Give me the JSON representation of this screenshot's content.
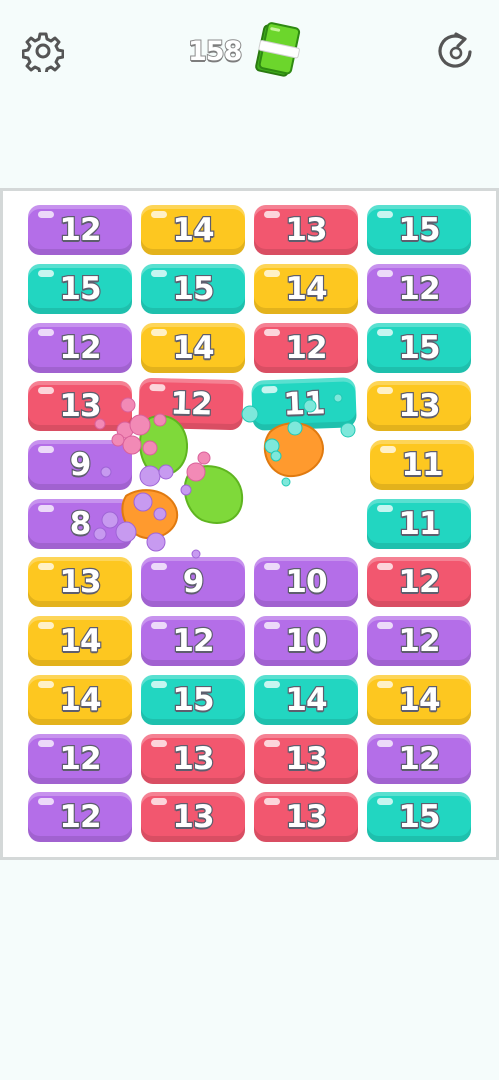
{
  "header": {
    "settings_icon": "gear-icon",
    "restart_icon": "restart-arrow-icon",
    "cash_icon": "cash-stack-icon",
    "score": "158"
  },
  "colors": {
    "purple": "#b46ee8",
    "yellow": "#fdc720",
    "pink": "#f2576f",
    "teal": "#22d6c1"
  },
  "board": {
    "tiles": [
      {
        "value": "12",
        "color": "purple"
      },
      {
        "value": "14",
        "color": "yellow"
      },
      {
        "value": "13",
        "color": "pink"
      },
      {
        "value": "15",
        "color": "teal"
      },
      {
        "value": "15",
        "color": "teal"
      },
      {
        "value": "15",
        "color": "teal"
      },
      {
        "value": "14",
        "color": "yellow"
      },
      {
        "value": "12",
        "color": "purple"
      },
      {
        "value": "12",
        "color": "purple"
      },
      {
        "value": "14",
        "color": "yellow"
      },
      {
        "value": "12",
        "color": "pink"
      },
      {
        "value": "15",
        "color": "teal"
      },
      {
        "value": "13",
        "color": "pink"
      },
      {
        "value": "12",
        "color": "pink"
      },
      {
        "value": "11",
        "color": "teal"
      },
      {
        "value": "13",
        "color": "yellow"
      },
      {
        "value": "9",
        "color": "purple"
      },
      {
        "value": "11",
        "color": "yellow"
      },
      {
        "value": "8",
        "color": "purple"
      },
      {
        "value": "11",
        "color": "teal"
      },
      {
        "value": "13",
        "color": "yellow"
      },
      {
        "value": "9",
        "color": "purple"
      },
      {
        "value": "10",
        "color": "purple"
      },
      {
        "value": "12",
        "color": "pink"
      },
      {
        "value": "14",
        "color": "yellow"
      },
      {
        "value": "12",
        "color": "purple"
      },
      {
        "value": "10",
        "color": "purple"
      },
      {
        "value": "12",
        "color": "purple"
      },
      {
        "value": "14",
        "color": "yellow"
      },
      {
        "value": "15",
        "color": "teal"
      },
      {
        "value": "14",
        "color": "teal"
      },
      {
        "value": "14",
        "color": "yellow"
      },
      {
        "value": "12",
        "color": "purple"
      },
      {
        "value": "13",
        "color": "pink"
      },
      {
        "value": "13",
        "color": "pink"
      },
      {
        "value": "12",
        "color": "purple"
      },
      {
        "value": "12",
        "color": "purple"
      },
      {
        "value": "13",
        "color": "pink"
      },
      {
        "value": "13",
        "color": "pink"
      },
      {
        "value": "15",
        "color": "teal"
      }
    ]
  }
}
